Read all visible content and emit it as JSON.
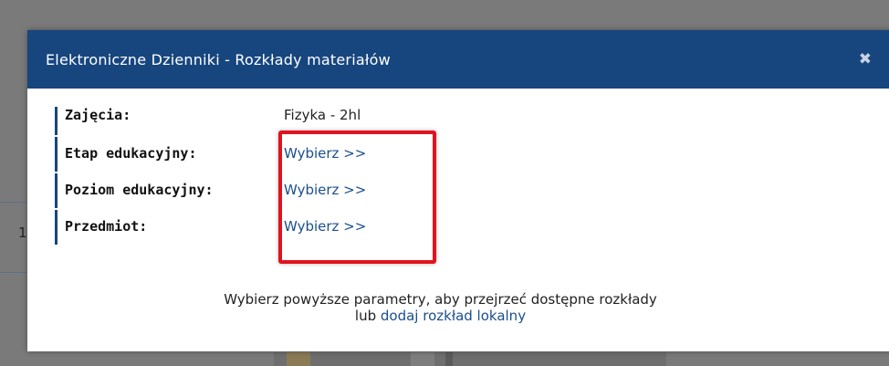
{
  "modal": {
    "title": "Elektroniczne Dzienniki - Rozkłady materiałów",
    "close_glyph": "✖"
  },
  "fields": [
    {
      "label": "Zajęcia:",
      "value": "Fizyka - 2hl"
    },
    {
      "label": "Etap edukacyjny:",
      "link": "Wybierz >>"
    },
    {
      "label": "Poziom edukacyjny:",
      "link": "Wybierz >>"
    },
    {
      "label": "Przedmiot:",
      "link": "Wybierz >>"
    }
  ],
  "footer": {
    "line1": "Wybierz powyższe parametry, aby przejrzeć dostępne rozkłady",
    "lub": "lub",
    "local_link": "dodaj rozkład lokalny"
  },
  "background": {
    "row_number": "1",
    "edge_char": "r"
  },
  "colors": {
    "header_bg": "#17467f",
    "link": "#1a4f8c",
    "highlight_border": "#e0141e"
  }
}
